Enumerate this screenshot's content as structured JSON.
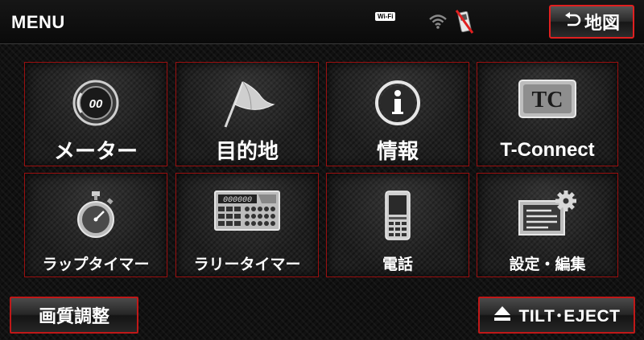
{
  "header": {
    "title": "MENU",
    "wifi_badge": "Wi-Fi",
    "map_button_label": "地図"
  },
  "tiles": [
    {
      "label": "メーター",
      "icon": "meter-icon"
    },
    {
      "label": "目的地",
      "icon": "destination-flag-icon"
    },
    {
      "label": "情報",
      "icon": "info-icon"
    },
    {
      "label": "T-Connect",
      "icon": "tconnect-logo-icon"
    },
    {
      "label": "ラップタイマー",
      "icon": "stopwatch-icon"
    },
    {
      "label": "ラリータイマー",
      "icon": "rally-timer-icon"
    },
    {
      "label": "電話",
      "icon": "phone-icon"
    },
    {
      "label": "設定・編集",
      "icon": "settings-edit-icon"
    }
  ],
  "footer": {
    "quality_label": "画質調整",
    "tilt_eject_label": "TILT･EJECT"
  },
  "icons": {
    "meter_display": "00",
    "tconnect_logo": "TC",
    "rally_display": "000000"
  },
  "colors": {
    "accent_red": "#e02020",
    "tile_border": "#9a1010",
    "background": "#111111"
  }
}
